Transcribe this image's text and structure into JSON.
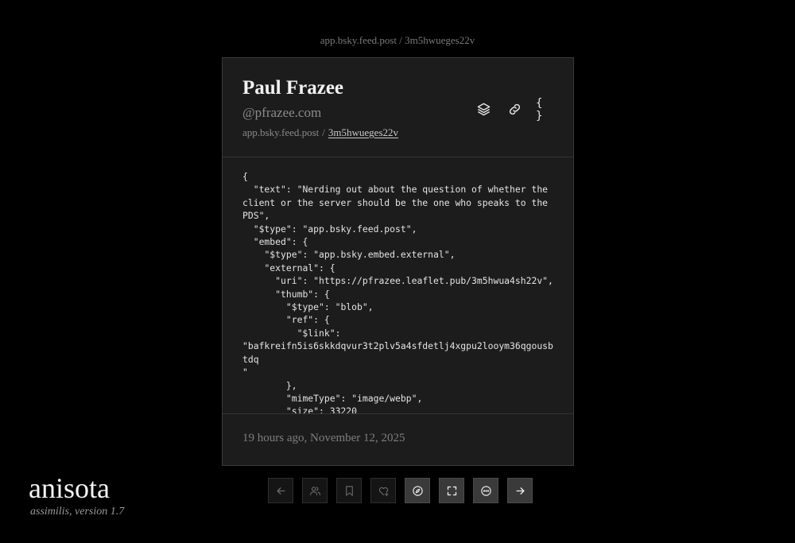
{
  "top_breadcrumb": "app.bsky.feed.post / 3m5hwueges22v",
  "post": {
    "author_name": "Paul Frazee",
    "author_handle": "@pfrazee.com",
    "collection": "app.bsky.feed.post",
    "separator": "/",
    "rkey": "3m5hwueges22v",
    "actions": [
      {
        "name": "layers-icon"
      },
      {
        "name": "link-icon"
      },
      {
        "name": "braces-icon",
        "glyph": "{ }"
      }
    ],
    "record_json": "{\n  \"text\": \"Nerding out about the question of whether the client or the server should be the one who speaks to the PDS\",\n  \"$type\": \"app.bsky.feed.post\",\n  \"embed\": {\n    \"$type\": \"app.bsky.embed.external\",\n    \"external\": {\n      \"uri\": \"https://pfrazee.leaflet.pub/3m5hwua4sh22v\",\n      \"thumb\": {\n        \"$type\": \"blob\",\n        \"ref\": {\n          \"$link\":\n\"bafkreifn5is6skkdqvur3t2plv5a4sfdetlj4xgpu2looym36qgousbtdq\n\"\n        },\n        \"mimeType\": \"image/webp\",\n        \"size\": 33220\n      },",
    "timestamp": "19 hours ago, November 12, 2025"
  },
  "bottom_nav": [
    {
      "name": "back-arrow-icon",
      "active": false
    },
    {
      "name": "users-icon",
      "active": false
    },
    {
      "name": "bookmark-icon",
      "active": false
    },
    {
      "name": "heart-add-icon",
      "active": false
    },
    {
      "name": "compass-icon",
      "active": true
    },
    {
      "name": "fullscreen-icon",
      "active": true
    },
    {
      "name": "more-icon",
      "active": true
    },
    {
      "name": "forward-arrow-icon",
      "active": true
    }
  ],
  "brand": {
    "name": "anisota",
    "tagline": "assimilis, version 1.7"
  },
  "colors": {
    "background": "#000000",
    "card": "#1c1c1c",
    "muted_text": "#7e7e7e",
    "active_button": "#3a3a3a"
  }
}
